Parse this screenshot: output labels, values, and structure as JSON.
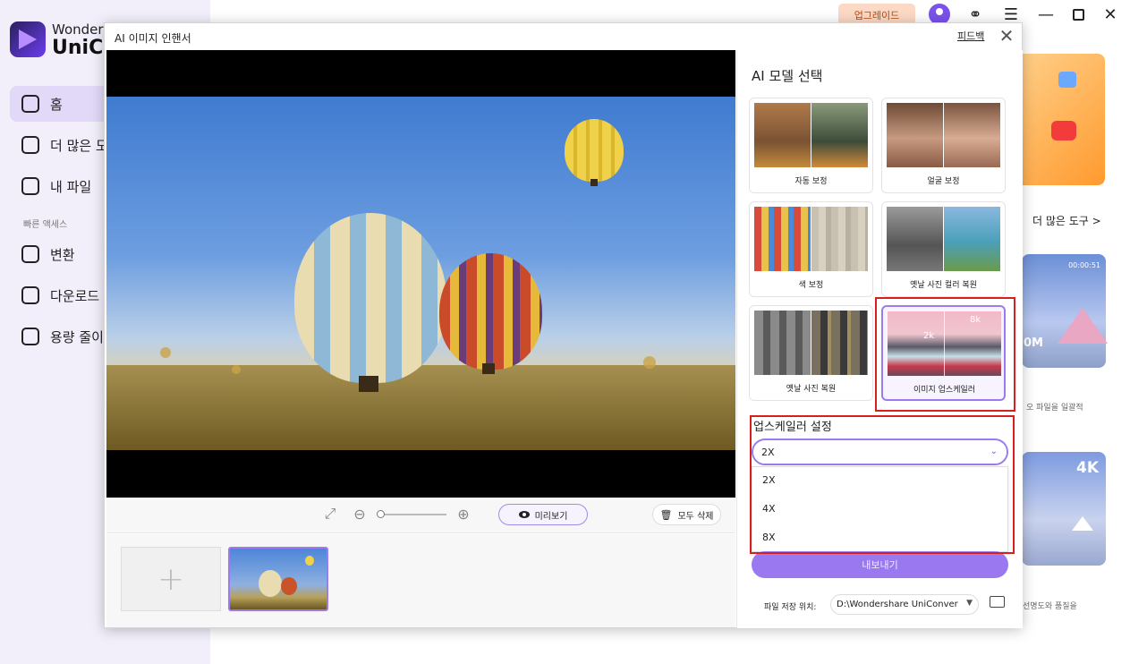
{
  "app": {
    "brand_line1": "Wonders",
    "brand_line2": "UniCo",
    "upgrade_label": "업그레이드",
    "nav": [
      {
        "label": "홈",
        "icon": "home-icon"
      },
      {
        "label": "더 많은 도",
        "icon": "toolbox-icon"
      },
      {
        "label": "내 파일",
        "icon": "file-icon"
      }
    ],
    "quick_access_label": "빠른 액세스",
    "quick_nav": [
      {
        "label": "변환",
        "icon": "convert-icon"
      },
      {
        "label": "다운로드",
        "icon": "download-icon"
      },
      {
        "label": "용량 줄이",
        "icon": "compress-icon"
      }
    ],
    "more_tools_label": "더 많은 도구 >",
    "card_timestamp": "00:00:51",
    "card_size_text": "0M",
    "card_4k_text": "4K",
    "card1_desc": "오 파일을 일괄적",
    "card2_desc": "선명도와 품질을"
  },
  "dialog": {
    "title": "AI 이미지 인핸서",
    "feedback_label": "피드백",
    "toolbar": {
      "preview_label": "미리보기",
      "delete_all_label": "모두 삭제"
    },
    "panel": {
      "model_title": "AI 모델 선택",
      "models": [
        {
          "label": "자동 보정"
        },
        {
          "label": "얼굴 보정"
        },
        {
          "label": "색 보정"
        },
        {
          "label": "옛날 사진 컬러 복원"
        },
        {
          "label": "옛날 사진 복원"
        },
        {
          "label": "이미지 업스케일러",
          "selected": true
        }
      ],
      "upscaler_title": "업스케일러 설정",
      "selected_scale": "2X",
      "scale_options": [
        "2X",
        "4X",
        "8X"
      ],
      "export_label": "내보내기",
      "save_location_label": "파일 저장 위치:",
      "save_path": "D:\\Wondershare UniConver",
      "upscale_badge_8k": "8k",
      "upscale_badge_2k": "2k"
    }
  },
  "colors": {
    "accent": "#9b7cf0",
    "highlight_box": "#d62020",
    "upgrade_bg": "#fbd9c5"
  }
}
